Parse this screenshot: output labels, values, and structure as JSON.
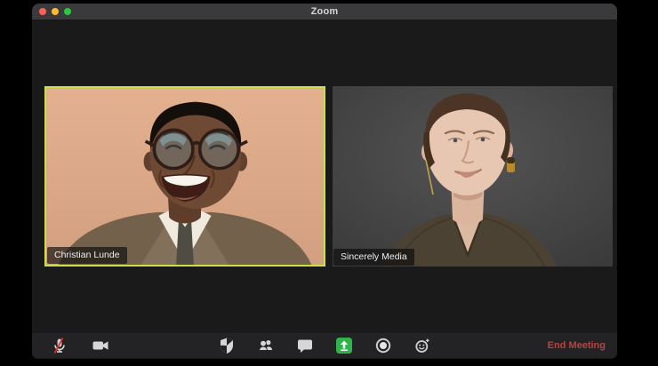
{
  "window": {
    "title": "Zoom"
  },
  "participants": [
    {
      "name": "Christian Lunde",
      "active_speaker": true
    },
    {
      "name": "Sincerely Media",
      "active_speaker": false
    }
  ],
  "toolbar": {
    "icons": [
      "microphone-muted-icon",
      "video-camera-icon",
      "security-shield-icon",
      "participants-icon",
      "chat-bubble-icon",
      "share-screen-icon",
      "record-icon",
      "reactions-icon"
    ],
    "end_meeting_label": "End Meeting"
  },
  "colors": {
    "active_speaker_border": "#cbe048",
    "share_screen_green": "#30b34a",
    "end_meeting_red": "#b8443f",
    "muted_mic_red": "#d9342b",
    "traffic_red": "#ff5f57",
    "traffic_yellow": "#febc2e",
    "traffic_green": "#28c840"
  }
}
